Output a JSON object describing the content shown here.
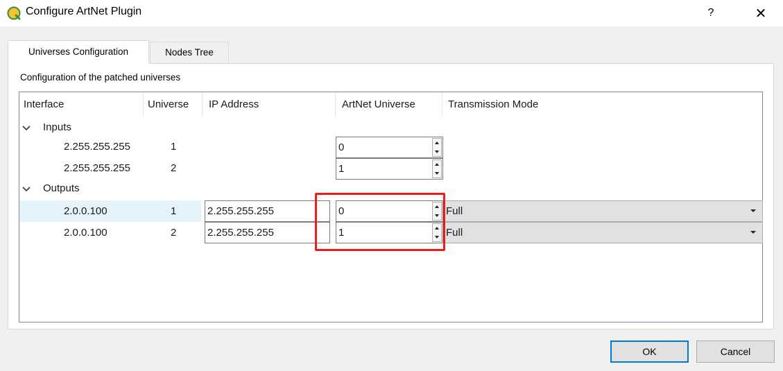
{
  "window": {
    "title": "Configure ArtNet Plugin",
    "help_label": "?",
    "close_label": "✕"
  },
  "tabs": [
    {
      "label": "Universes Configuration",
      "active": true
    },
    {
      "label": "Nodes Tree",
      "active": false
    }
  ],
  "group_caption": "Configuration of the patched universes",
  "columns": [
    "Interface",
    "Universe",
    "IP Address",
    "ArtNet Universe",
    "Transmission Mode"
  ],
  "groups": [
    {
      "label": "Inputs",
      "expanded": true,
      "rows": [
        {
          "interface": "2.255.255.255",
          "universe": "1",
          "artnet_universe": "0"
        },
        {
          "interface": "2.255.255.255",
          "universe": "2",
          "artnet_universe": "1"
        }
      ]
    },
    {
      "label": "Outputs",
      "expanded": true,
      "rows": [
        {
          "interface": "2.0.0.100",
          "universe": "1",
          "ip_address": "2.255.255.255",
          "artnet_universe": "0",
          "transmission_mode": "Full",
          "selected": true
        },
        {
          "interface": "2.0.0.100",
          "universe": "2",
          "ip_address": "2.255.255.255",
          "artnet_universe": "1",
          "transmission_mode": "Full"
        }
      ]
    }
  ],
  "buttons": {
    "ok": "OK",
    "cancel": "Cancel"
  },
  "colors": {
    "annotation_box": "#ee1c1c",
    "selection": "#e5f3fb",
    "default_button_border": "#0078d7",
    "icon_yellow": "#f4c430",
    "icon_green": "#3a8f3a"
  }
}
